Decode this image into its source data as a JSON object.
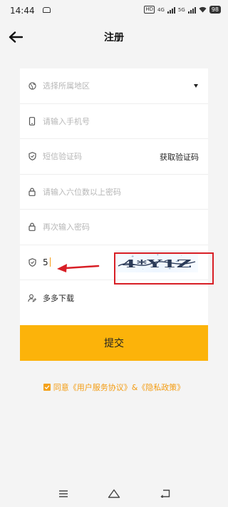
{
  "status": {
    "time": "14:44",
    "network_badge_1": "4G",
    "network_badge_2": "5G",
    "battery": "98"
  },
  "header": {
    "title": "注册"
  },
  "form": {
    "region_placeholder": "选择所属地区",
    "phone_placeholder": "请输入手机号",
    "sms_placeholder": "短信验证码",
    "get_code_label": "获取验证码",
    "password_placeholder": "请输入六位数以上密码",
    "confirm_password_placeholder": "再次输入密码",
    "captcha_value": "5",
    "captcha_image_text": "4*Y1Z",
    "inviter_value": "多多下载"
  },
  "submit_label": "提交",
  "agreement": {
    "prefix": "同意",
    "terms_link": "《用户服务协议》",
    "connector": "&",
    "privacy_link": "《隐私政策》"
  },
  "colors": {
    "accent": "#fcb30a",
    "highlight": "#d81f26",
    "link": "#f39c12"
  }
}
